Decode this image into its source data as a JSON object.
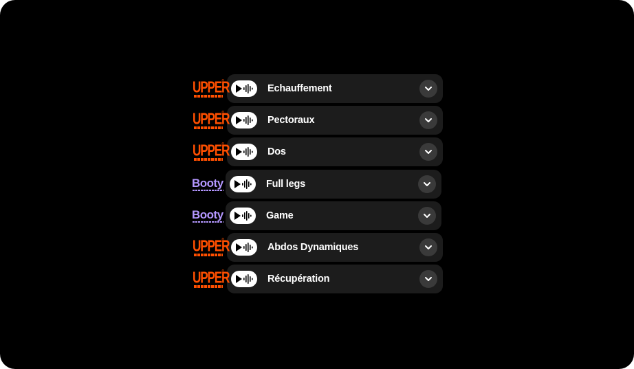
{
  "rows": [
    {
      "brand": "UPPER",
      "brand_color": "#ff4f00",
      "label": "Echauffement",
      "play_icon": "play-waveform-icon",
      "expand_icon": "chevron-down-icon"
    },
    {
      "brand": "UPPER",
      "brand_color": "#ff4f00",
      "label": "Pectoraux",
      "play_icon": "play-waveform-icon",
      "expand_icon": "chevron-down-icon"
    },
    {
      "brand": "UPPER",
      "brand_color": "#ff4f00",
      "label": "Dos",
      "play_icon": "play-waveform-icon",
      "expand_icon": "chevron-down-icon"
    },
    {
      "brand": "Booty",
      "brand_color": "#b497ff",
      "label": "Full legs",
      "play_icon": "play-waveform-icon",
      "expand_icon": "chevron-down-icon"
    },
    {
      "brand": "Booty",
      "brand_color": "#b497ff",
      "label": "Game",
      "play_icon": "play-waveform-icon",
      "expand_icon": "chevron-down-icon"
    },
    {
      "brand": "UPPER",
      "brand_color": "#ff4f00",
      "label": "Abdos Dynamiques",
      "play_icon": "play-waveform-icon",
      "expand_icon": "chevron-down-icon"
    },
    {
      "brand": "UPPER",
      "brand_color": "#ff4f00",
      "label": "Récupération",
      "play_icon": "play-waveform-icon",
      "expand_icon": "chevron-down-icon"
    }
  ],
  "colors": {
    "background": "#000000",
    "card": "#1c1c1c",
    "chevron_bg": "#3a3a3a",
    "text": "#ffffff"
  }
}
